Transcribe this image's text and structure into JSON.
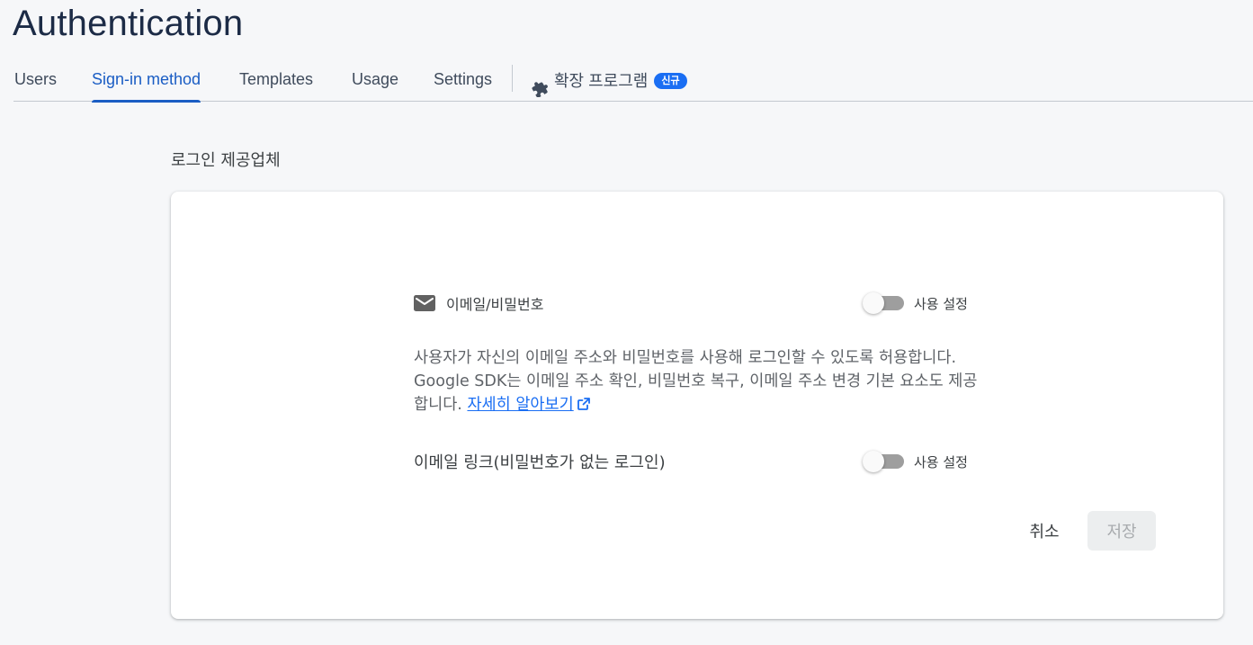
{
  "header": {
    "title": "Authentication"
  },
  "tabs": [
    {
      "label": "Users",
      "active": false
    },
    {
      "label": "Sign-in method",
      "active": true
    },
    {
      "label": "Templates",
      "active": false
    },
    {
      "label": "Usage",
      "active": false
    },
    {
      "label": "Settings",
      "active": false
    }
  ],
  "extensions_tab": {
    "label": "확장 프로그램",
    "badge": "신규",
    "icon": "puzzle-icon"
  },
  "section": {
    "title": "로그인 제공업체"
  },
  "provider": {
    "name": "이메일/비밀번호",
    "icon": "mail-icon",
    "toggle_label": "사용 설정",
    "enabled": false,
    "description": "사용자가 자신의 이메일 주소와 비밀번호를 사용해 로그인할 수 있도록 허용합니다. Google SDK는 이메일 주소 확인, 비밀번호 복구, 이메일 주소 변경 기본 요소도 제공합니다.",
    "learn_more": "자세히 알아보기"
  },
  "email_link": {
    "label": "이메일 링크(비밀번호가 없는 로그인)",
    "toggle_label": "사용 설정",
    "enabled": false
  },
  "actions": {
    "cancel": "취소",
    "save": "저장"
  },
  "colors": {
    "accent": "#1a5dc4",
    "badge": "#1a6ef3",
    "title": "#1c2b46",
    "background": "#f6f7f9"
  }
}
